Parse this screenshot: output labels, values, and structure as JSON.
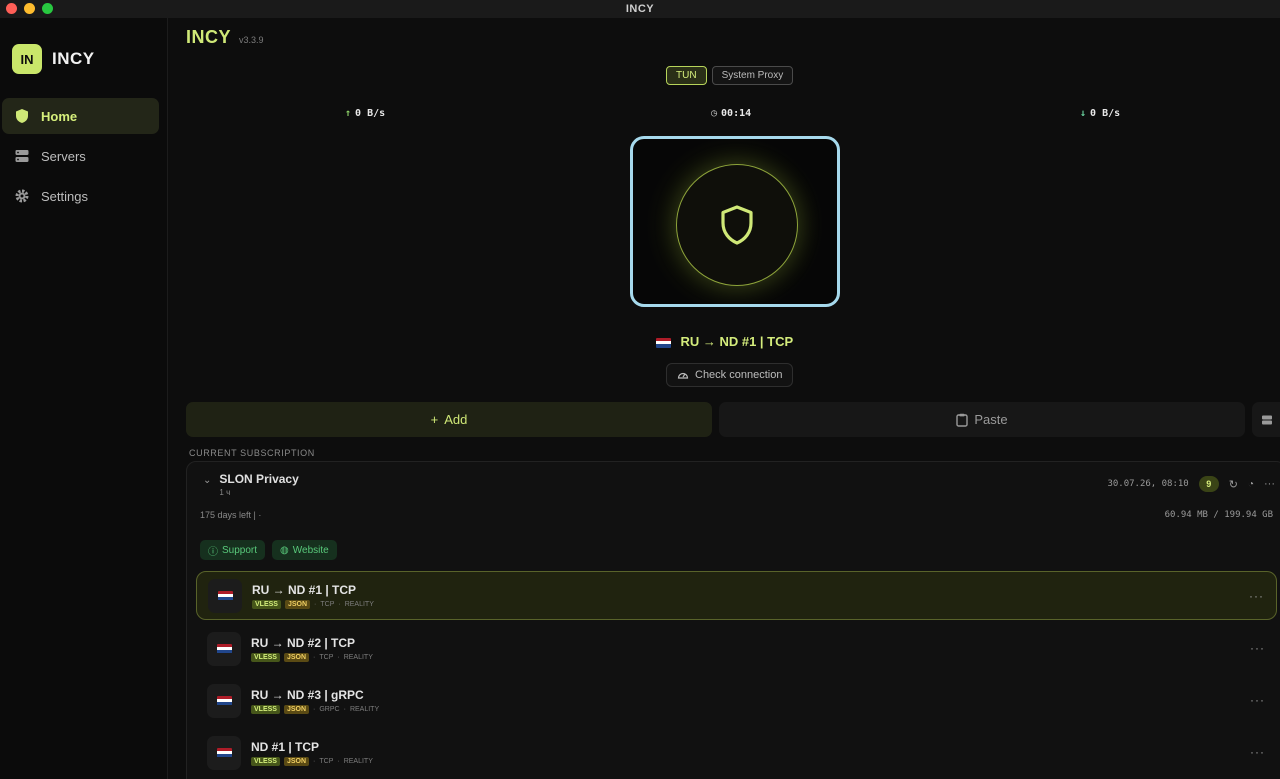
{
  "window": {
    "title": "INCY"
  },
  "sidebar": {
    "logo_text": "IN",
    "brand": "INCY",
    "items": [
      {
        "label": "Home",
        "icon": "shield-icon",
        "active": true
      },
      {
        "label": "Servers",
        "icon": "servers-icon",
        "active": false
      },
      {
        "label": "Settings",
        "icon": "gear-icon",
        "active": false
      }
    ]
  },
  "header": {
    "title": "INCY",
    "version": "v3.3.9"
  },
  "modes": {
    "tun": "TUN",
    "system_proxy": "System Proxy",
    "selected": "TUN"
  },
  "stats": {
    "upload": "0 B/s",
    "time": "00:14",
    "download": "0 B/s"
  },
  "connection": {
    "current_server": "RU → ND #1 | TCP",
    "check_label": "Check connection"
  },
  "actions": {
    "add": "Add",
    "paste": "Paste"
  },
  "subscription": {
    "section_label": "CURRENT SUBSCRIPTION",
    "name": "SLON Privacy",
    "subtitle": "1 ч",
    "updated": "30.07.26, 08:10",
    "server_count": "9",
    "days_left": "175 days left  |  ·",
    "traffic": "60.94 MB / 199.94 GB",
    "links": {
      "support": "Support",
      "website": "Website"
    }
  },
  "servers": [
    {
      "name": "RU → ND #1 | TCP",
      "tag1": "VLESS",
      "tag2": "JSON",
      "transport": "TCP",
      "security": "REALITY",
      "active": true
    },
    {
      "name": "RU → ND #2 | TCP",
      "tag1": "VLESS",
      "tag2": "JSON",
      "transport": "TCP",
      "security": "REALITY",
      "active": false
    },
    {
      "name": "RU → ND #3 | gRPC",
      "tag1": "VLESS",
      "tag2": "JSON",
      "transport": "GRPC",
      "security": "REALITY",
      "active": false
    },
    {
      "name": "ND #1 | TCP",
      "tag1": "VLESS",
      "tag2": "JSON",
      "transport": "TCP",
      "security": "REALITY",
      "active": false
    }
  ],
  "colors": {
    "accent": "#cfe877",
    "active_bg": "#20230f",
    "focus_ring": "#a6d9ec"
  }
}
